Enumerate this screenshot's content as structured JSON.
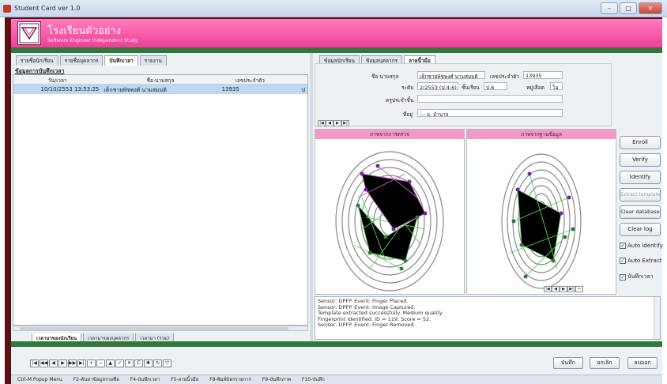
{
  "window": {
    "title": "Student Card ver 1.0",
    "controls": [
      "–",
      "□",
      "✕"
    ]
  },
  "banner": {
    "school_name": "โรงเรียนตัวอย่าง",
    "subtitle": "Software Engineer Independent Study"
  },
  "left": {
    "tabs": [
      "รายชื่อนักเรียน",
      "รายชื่อบุคลากร",
      "บันทึกเวลา",
      "รายงาน"
    ],
    "section_title": "ข้อมูลการบันทึกเวลา",
    "columns": [
      "วัน/เวลา",
      "ชื่อ-นามสกุล",
      "เลขประจำตัว",
      ""
    ],
    "rows": [
      {
        "datetime": "10/10/2553 13:53:25",
        "name": "เด็กชายพัชพงศ์ นามสมมติ",
        "id": "13935",
        "extra": "ป"
      }
    ],
    "bottom_tabs": [
      "เวลามาของนักเรียน",
      "เวลามาของบุคลากร",
      "เวลามา (รวม)"
    ]
  },
  "right": {
    "tabs": [
      "ข้อมูลนักเรียน",
      "ข้อมูลบุคลากร",
      "ลายนิ้วมือ"
    ],
    "fields": {
      "name_label": "ชื่อ นามสกุล",
      "name_value": "เด็กชายพัชพงศ์ นามสมมติ",
      "id_label": "เลขประจำตัว",
      "id_value": "13935",
      "level_label": "ระดับ",
      "level_value": "2/2553 (ป.4-6)",
      "class_label": "ชั้นเรียน",
      "class_value": "ป.6",
      "blood_label": "หมู่เลือด",
      "blood_value": "โอ",
      "teacher_label": "ครูประจำชั้น",
      "teacher_value": "",
      "address_label": "ที่อยู่",
      "address_value": "--- อ. อำนาจ"
    },
    "record_nav": [
      "|◀",
      "◀",
      "▶",
      "▶|"
    ],
    "image_left_caption": "ภาพจากการตรวจ",
    "image_right_caption": "ภาพจากฐานข้อมูล",
    "image_nav": [
      "|◀",
      "◀",
      "▶",
      "▶|",
      "—"
    ],
    "buttons": [
      "Enroll",
      "Verify",
      "Identify",
      "Extract template",
      "Clear database",
      "Clear log"
    ],
    "checkboxes": [
      {
        "label": "Auto identify",
        "checked": true
      },
      {
        "label": "Auto Extract",
        "checked": true
      },
      {
        "label": "บันทึกเวลา",
        "checked": true
      }
    ],
    "log_lines": [
      "Sensor: DPFP. Event: Finger Placed.",
      "Sensor: DPFP. Event: Image Captured.",
      "Template extracted successfully. Medium quality.",
      "Fingerprint identified. ID = 119. Score = 52.",
      "Sensor: DPFP. Event: Finger Removed."
    ]
  },
  "toolbar": {
    "nav_buttons": [
      "|◀",
      "◀◀",
      "◀",
      "▶",
      "▶▶",
      "▶|",
      "+",
      "−",
      "▲",
      "✓",
      "✕",
      "C",
      "✱",
      "↻",
      "▽"
    ],
    "save_label": "บันทึก",
    "cancel_label": "ยกเลิก",
    "delete_label": "ลบออก"
  },
  "statusbar": [
    "Ctrl-M Popup Menu",
    "F2-ค้นหาข้อมูลรายชื่อ",
    "F4-บันทึกเวลา",
    "F5-ลายนิ้วมือ",
    "F8-พิมพ์บัตรรายการ",
    "F9-บันทึกภาพ",
    "F10-บันทึก"
  ]
}
